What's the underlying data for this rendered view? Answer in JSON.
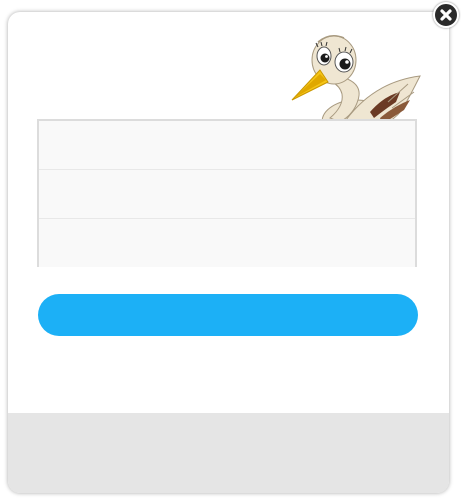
{
  "dialog": {
    "mascot": "stork-mascot-icon",
    "fields": [
      {
        "value": "",
        "placeholder": ""
      },
      {
        "value": "",
        "placeholder": ""
      },
      {
        "value": "",
        "placeholder": ""
      }
    ],
    "submit_label": "",
    "close_icon": "close-icon"
  },
  "colors": {
    "accent": "#1cb0f6",
    "field_bg": "#f9f9f9",
    "field_border": "#dcdcdc",
    "footer_bg": "#e5e5e5",
    "close_bg": "#2a2a2a"
  }
}
